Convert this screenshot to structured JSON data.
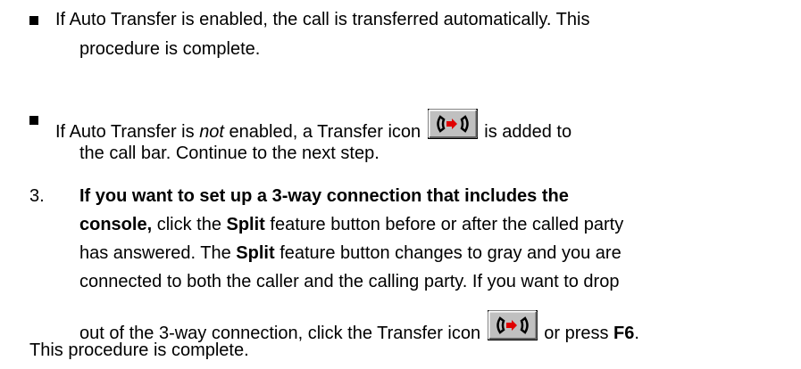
{
  "bullets": [
    {
      "line1": "If Auto Transfer is enabled, the call is transferred automatically.  This",
      "line2": "procedure is complete."
    },
    {
      "line1_a": "If Auto Transfer is ",
      "line1_em": "not",
      "line1_b": " enabled, a Transfer icon ",
      "line1_c": " is added to",
      "line2": "the call bar.  Continue to the next step."
    }
  ],
  "step3": {
    "number": "3.",
    "bold_lead_1": "If you want to set up a 3-way connection that includes the",
    "bold_lead_2": "console,",
    "line2_rest": " click the ",
    "split_1": "Split",
    "line2_tail": " feature button before or after the called party",
    "line3_a": "has answered. The ",
    "split_2": "Split",
    "line3_b": " feature button changes to gray and you are",
    "line4": "connected to both the caller and the calling party.  If you want to drop",
    "line5_a": "out of the 3-way connection, click the Transfer icon ",
    "line5_b": " or press ",
    "f6": "F6",
    "line5_c": ".",
    "line6": "This procedure is complete."
  },
  "icons": {
    "transfer_icon": "transfer-icon"
  }
}
